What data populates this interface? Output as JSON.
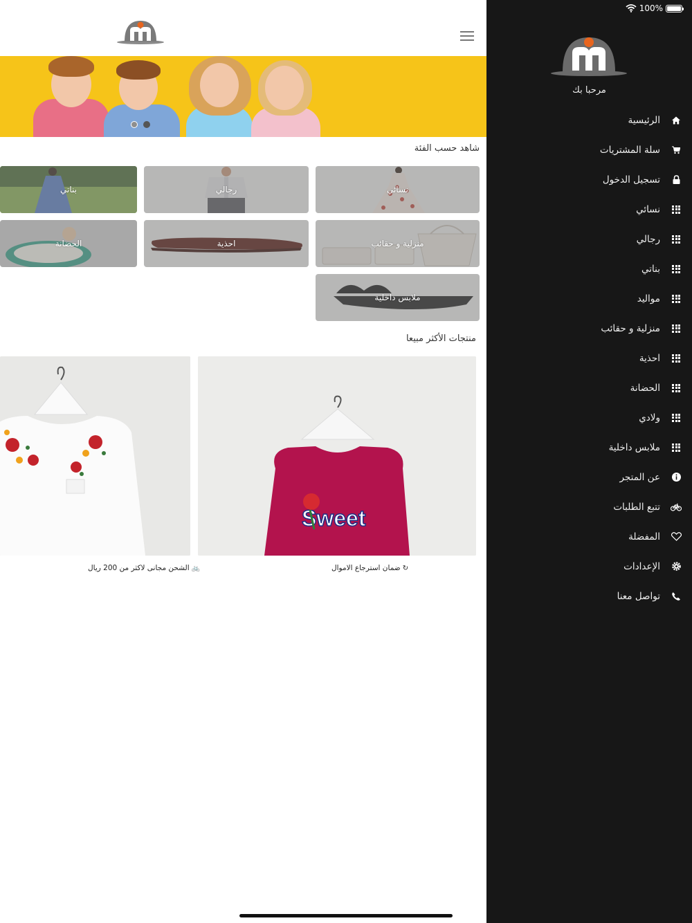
{
  "status_bar": {
    "battery_text": "100%",
    "wifi_icon": "wifi-icon",
    "battery_level": 1.0
  },
  "header": {
    "logo_icon": "store-logo-icon",
    "menu_icon": "hamburger-menu-icon"
  },
  "banner": {
    "slide_count": 2,
    "active_slide": 1
  },
  "categories": {
    "heading": "شاهد حسب الفئة",
    "tiles": [
      {
        "label": "نسائي"
      },
      {
        "label": "رجالي"
      },
      {
        "label": "بناتي"
      },
      {
        "label": "منزلية و حقائب"
      },
      {
        "label": "احذية"
      },
      {
        "label": "الحضانة"
      },
      {
        "label": "ملابس داخلية"
      }
    ]
  },
  "bestsellers": {
    "heading": "منتجات الأكثر مبيعا",
    "products": [
      {
        "name": "Sweet",
        "color": "#b3134d"
      },
      {
        "name": "",
        "color": "#f6f6f4"
      }
    ]
  },
  "features": [
    {
      "text": "ضمان استرجاع الاموال",
      "icon": "refresh-icon"
    },
    {
      "text": "الشحن مجانى لاكثر من 200 ريال",
      "icon": "bicycle-icon"
    }
  ],
  "drawer": {
    "welcome": "مرحبا بك",
    "items": [
      {
        "label": "الرئيسية",
        "icon": "home-icon"
      },
      {
        "label": "سلة المشتريات",
        "icon": "cart-icon"
      },
      {
        "label": "تسجيل الدخول",
        "icon": "lock-icon"
      },
      {
        "label": "نسائي",
        "icon": "grid-icon"
      },
      {
        "label": "رجالي",
        "icon": "grid-icon"
      },
      {
        "label": "بناتي",
        "icon": "grid-icon"
      },
      {
        "label": "مواليد",
        "icon": "grid-icon"
      },
      {
        "label": "منزلية و حقائب",
        "icon": "grid-icon"
      },
      {
        "label": "احذية",
        "icon": "grid-icon"
      },
      {
        "label": "الحضانة",
        "icon": "grid-icon"
      },
      {
        "label": "ولادي",
        "icon": "grid-icon"
      },
      {
        "label": "ملابس داخلية",
        "icon": "grid-icon"
      },
      {
        "label": "عن المتجر",
        "icon": "info-icon"
      },
      {
        "label": "تتبع الطلبات",
        "icon": "bicycle-icon"
      },
      {
        "label": "المفضلة",
        "icon": "heart-icon"
      },
      {
        "label": "الإعدادات",
        "icon": "gear-icon"
      },
      {
        "label": "تواصل معنا",
        "icon": "phone-icon"
      }
    ]
  },
  "colors": {
    "drawer_bg": "#171717",
    "banner_bg": "#f6c419",
    "brand_orange": "#e8651e",
    "brand_gray": "#6b6b6b"
  }
}
